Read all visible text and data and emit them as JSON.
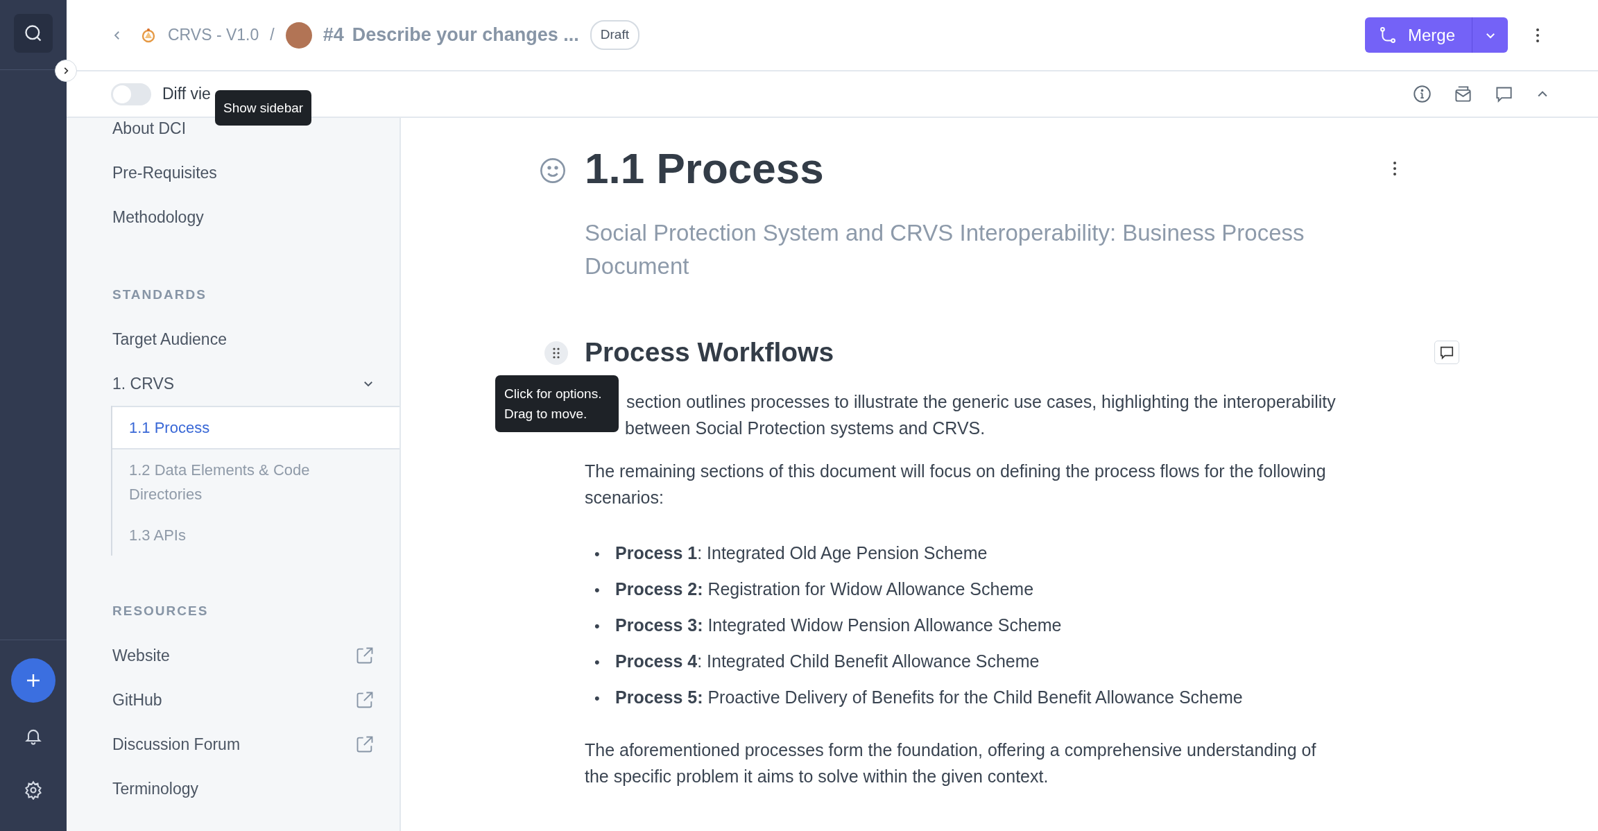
{
  "header": {
    "space": "CRVS - V1.0",
    "separator": "/",
    "change_request": {
      "number": "#4",
      "title": "Describe your changes ...",
      "status": "Draft"
    },
    "merge_button": "Merge"
  },
  "toolbar": {
    "diff_view": {
      "label": "Diff vie",
      "on": false
    }
  },
  "tooltips": [
    {
      "kind": "sidebar",
      "lines": [
        "Show sidebar"
      ]
    },
    {
      "kind": "block",
      "lines": [
        "Click for options.",
        "Drag to move."
      ]
    }
  ],
  "sidebar": {
    "items": [
      {
        "kind": "page",
        "label": "About DCI"
      },
      {
        "kind": "page",
        "label": "Pre-Requisites"
      },
      {
        "kind": "page",
        "label": "Methodology"
      },
      {
        "kind": "section",
        "label": "STANDARDS"
      },
      {
        "kind": "page",
        "label": "Target Audience"
      },
      {
        "kind": "page",
        "label": "1. CRVS",
        "expanded": true,
        "children": [
          {
            "label": "1.1 Process",
            "selected": true
          },
          {
            "label": "1.2 Data Elements & Code Directories",
            "selected": false
          },
          {
            "label": "1.3 APIs",
            "selected": false
          }
        ]
      },
      {
        "kind": "section",
        "label": "RESOURCES"
      },
      {
        "kind": "external",
        "label": "Website"
      },
      {
        "kind": "external",
        "label": "GitHub"
      },
      {
        "kind": "external",
        "label": "Discussion Forum"
      },
      {
        "kind": "page",
        "label": "Terminology"
      }
    ]
  },
  "document": {
    "title": "1.1 Process",
    "subtitle": "Social Protection System and CRVS Interoperability: Business Process Document",
    "heading": "Process Workflows",
    "blocks": [
      {
        "kind": "lines",
        "lines": [
          "section outlines processes to illustrate the generic use cases, highlighting the interoperability",
          "between Social Protection systems and CRVS."
        ]
      },
      {
        "kind": "paragraph",
        "text": "The remaining sections of this document will focus on defining the process flows for the following scenarios:"
      },
      {
        "kind": "list",
        "marker": "•",
        "items": [
          "**Process 1**: Integrated Old Age Pension Scheme",
          "**Process 2:** Registration for Widow Allowance Scheme",
          "**Process 3:** Integrated Widow Pension Allowance Scheme",
          "**Process 4**: Integrated Child Benefit Allowance Scheme",
          "**Process 5:** Proactive Delivery of Benefits for the Child Benefit Allowance Scheme"
        ]
      },
      {
        "kind": "paragraph",
        "text": "The aforementioned processes form the foundation, offering a comprehensive understanding of the specific problem it aims to solve within the given context."
      }
    ]
  }
}
